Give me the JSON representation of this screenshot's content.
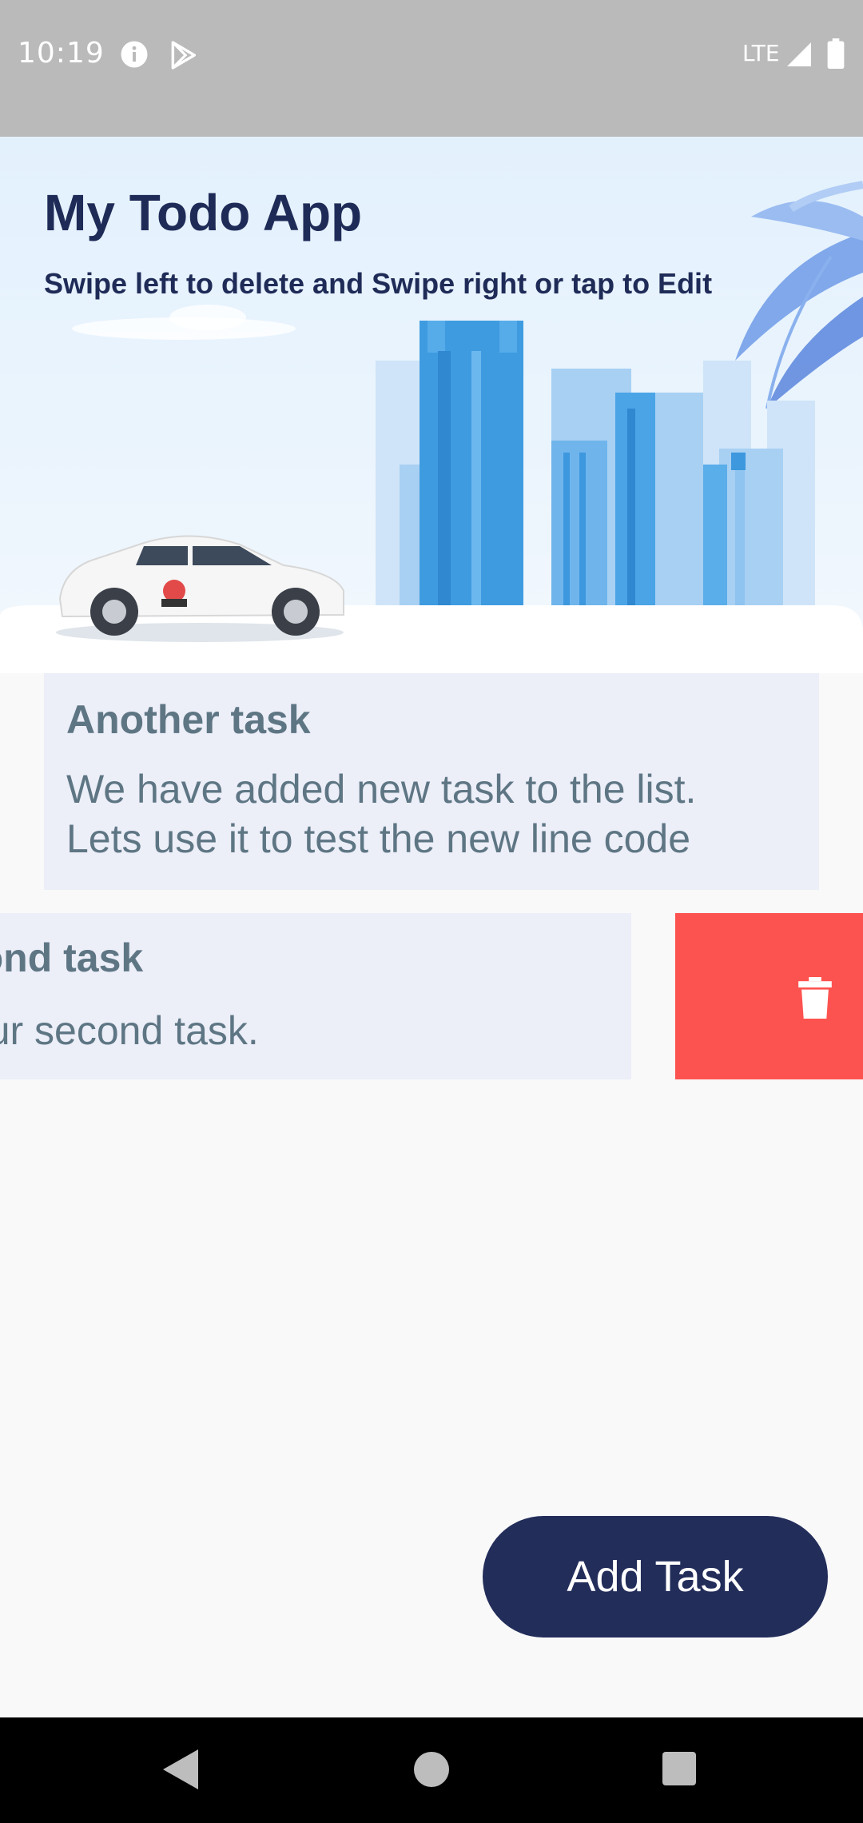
{
  "status_bar": {
    "time": "10:19",
    "network": "LTE",
    "icons": [
      "info-icon",
      "play-store-icon",
      "signal-icon",
      "battery-icon"
    ]
  },
  "header": {
    "title": "My Todo App",
    "subtitle": "Swipe left to delete and Swipe right or tap to Edit",
    "illustration": "city-skyline-with-car"
  },
  "tasks": [
    {
      "title": "Another task",
      "description_lines": [
        "We have added new task to the list.",
        "Lets use it to test the new line code"
      ]
    },
    {
      "title": "econd task",
      "description_lines": [
        "s our second task."
      ],
      "swiped": true
    }
  ],
  "delete_action": {
    "icon": "trash-icon",
    "color": "#fd5350"
  },
  "add_task_button": {
    "label": "Add Task",
    "color": "#222d5a"
  },
  "nav_bar": {
    "icons": [
      "back-icon",
      "home-icon",
      "recents-icon"
    ]
  },
  "colors": {
    "title": "#1f2b57",
    "card_bg": "#eceef8",
    "card_text": "#5e7684",
    "page_bg": "#f9f9fa"
  }
}
